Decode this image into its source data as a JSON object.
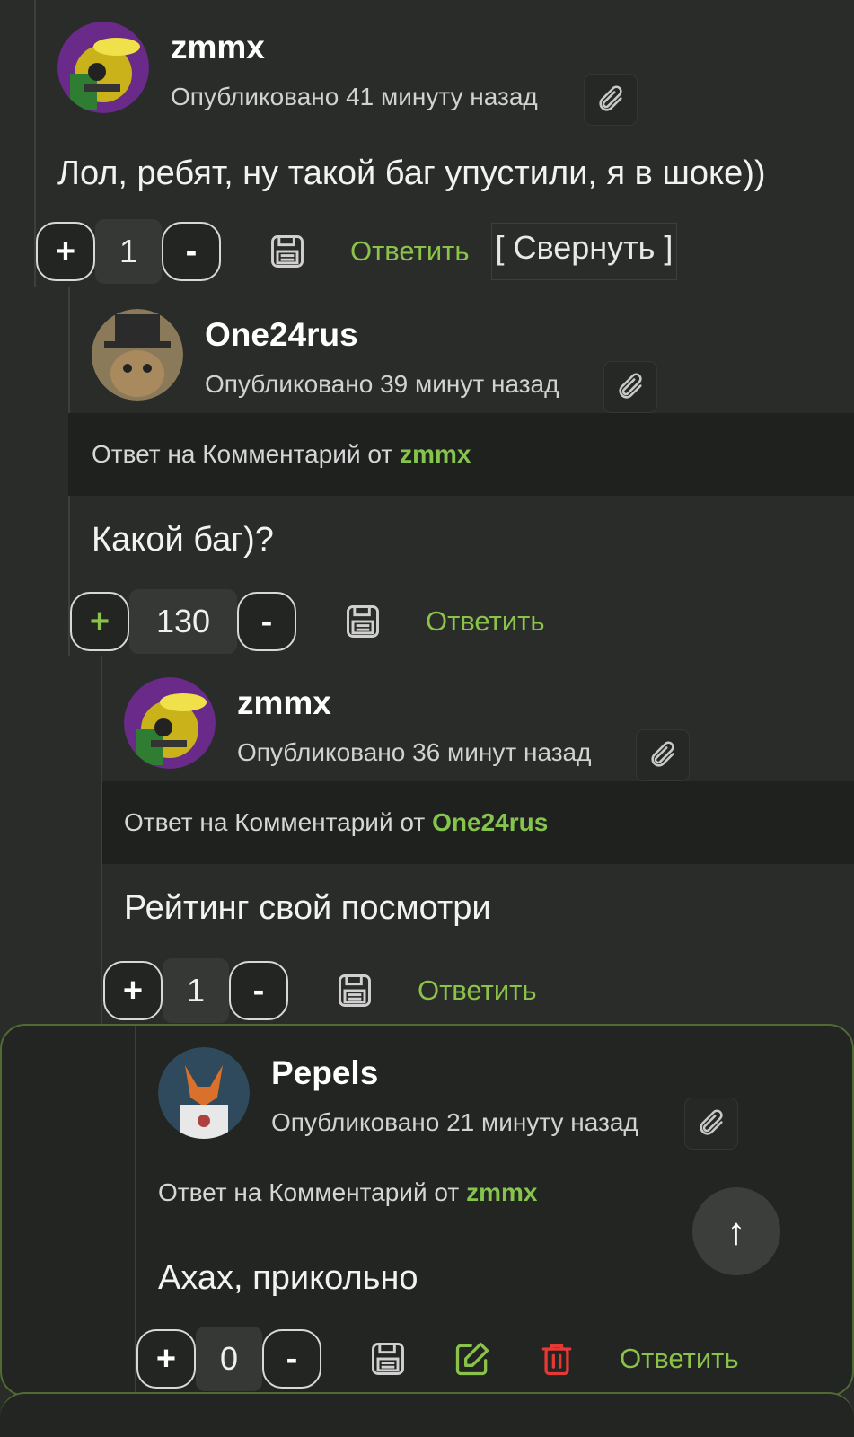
{
  "comments": [
    {
      "author": "zmmx",
      "posted": "Опубликовано 41 минуту назад",
      "text": "Лол, ребят, ну такой баг упустили, я в шоке))",
      "score": "1",
      "reply_label": "Ответить",
      "collapse_label": "[ Свернуть ]"
    },
    {
      "author": "One24rus",
      "posted": "Опубликовано 39 минут назад",
      "reply_to_prefix": "Ответ на Комментарий от",
      "reply_to": "zmmx",
      "text": "Какой баг)?",
      "score": "130",
      "reply_label": "Ответить"
    },
    {
      "author": "zmmx",
      "posted": "Опубликовано 36 минут назад",
      "reply_to_prefix": "Ответ на Комментарий от",
      "reply_to": "One24rus",
      "text": "Рейтинг свой посмотри",
      "score": "1",
      "reply_label": "Ответить"
    },
    {
      "author": "Pepels",
      "posted": "Опубликовано 21 минуту назад",
      "reply_to_prefix": "Ответ на Комментарий от",
      "reply_to": "zmmx",
      "text": "Ахах, прикольно",
      "score": "0",
      "reply_label": "Ответить"
    }
  ],
  "vote": {
    "plus": "+",
    "minus": "-"
  },
  "scroll_top_glyph": "↑",
  "colors": {
    "accent": "#8bc34a",
    "delete": "#e53935",
    "highlight_border": "#4f6b33"
  },
  "icons": [
    "paperclip-icon",
    "save-icon",
    "edit-icon",
    "trash-icon",
    "arrow-up-icon"
  ]
}
